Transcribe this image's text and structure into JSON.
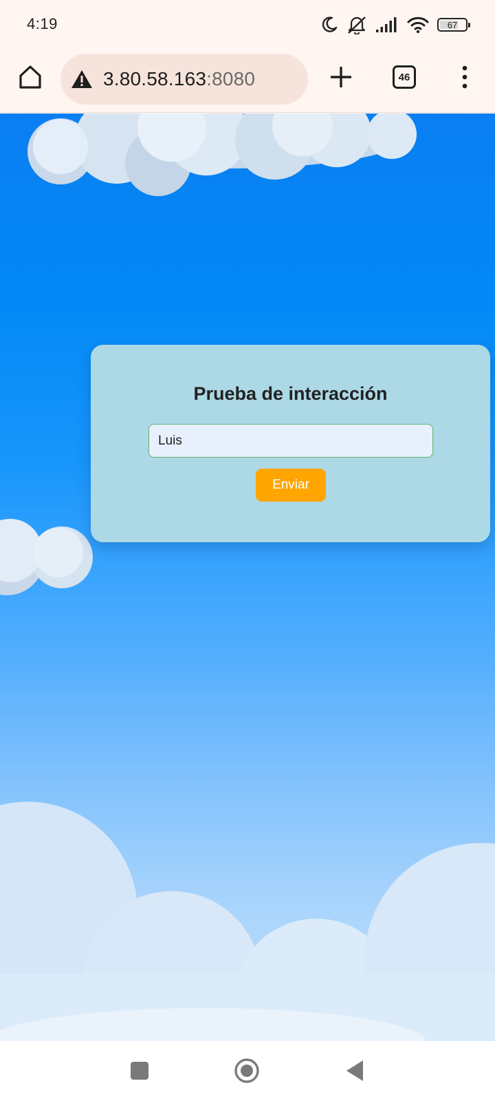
{
  "status_bar": {
    "time": "4:19",
    "battery_level": "67",
    "icons": [
      "moon-icon",
      "mute-icon",
      "signal-icon",
      "wifi-icon",
      "battery-icon"
    ]
  },
  "browser": {
    "url_host": "3.80.58.163",
    "url_port": ":8080",
    "tab_count": "46",
    "icons": [
      "home-icon",
      "warning-icon",
      "plus-icon",
      "tabs-icon",
      "menu-icon"
    ]
  },
  "page": {
    "title": "Prueba de interacción",
    "input_value": "Luis",
    "submit_label": "Enviar",
    "colors": {
      "card": "#add8e6",
      "button": "#ffa500",
      "input_bg": "#e8f0fe",
      "input_border": "#5fb56d",
      "sky_top": "#0a7ff2",
      "sky_bottom": "#c0dffa"
    }
  },
  "nav_bar": {
    "icons": [
      "recents-icon",
      "home-circle-icon",
      "back-icon"
    ]
  }
}
